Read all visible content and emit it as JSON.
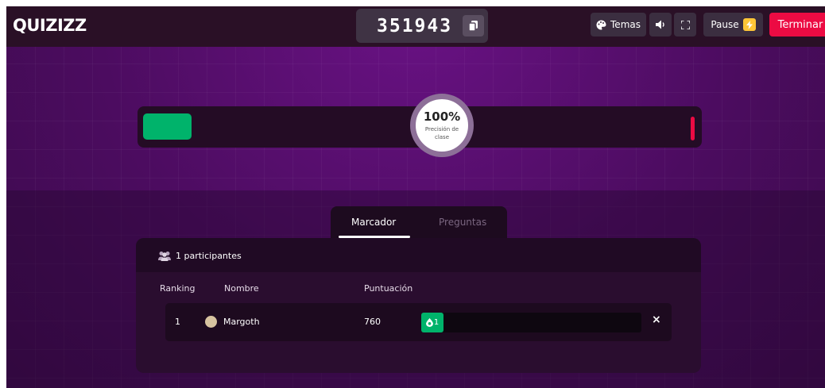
{
  "app": {
    "logo": "QUIZIZZ"
  },
  "game": {
    "code": "351943"
  },
  "toolbar": {
    "themes_label": "Temas",
    "pause_label": "Pause",
    "end_label": "Terminar"
  },
  "accuracy": {
    "value_text": "100%",
    "label": "Precisión de clase",
    "correct_fraction": 1.0
  },
  "tabs": [
    {
      "label": "Marcador",
      "active": true
    },
    {
      "label": "Preguntas",
      "active": false
    }
  ],
  "leaderboard": {
    "participants_label": "1 participantes",
    "columns": {
      "rank": "Ranking",
      "name": "Nombre",
      "score": "Puntuación"
    },
    "rows": [
      {
        "rank": "1",
        "name": "Margoth",
        "score": "760",
        "correct": "1"
      }
    ]
  },
  "colors": {
    "accent_red": "#ec0b43",
    "correct_green": "#00b36b",
    "pause_yellow": "#ffc637"
  }
}
